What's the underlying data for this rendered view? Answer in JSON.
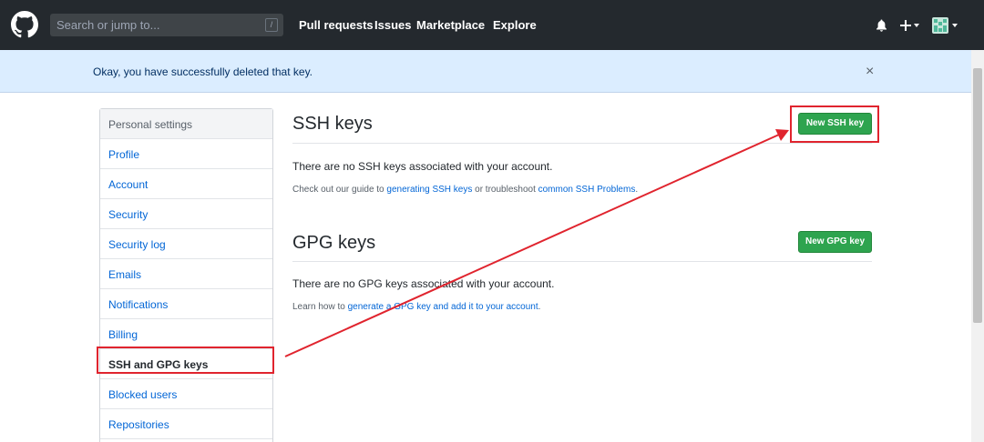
{
  "header": {
    "search_placeholder": "Search or jump to...",
    "slash_hint": "/",
    "nav": [
      "Pull requests",
      "Issues",
      "Marketplace",
      "Explore"
    ]
  },
  "flash": {
    "message": "Okay, you have successfully deleted that key.",
    "close": "×"
  },
  "sidebar": {
    "heading": "Personal settings",
    "items": [
      "Profile",
      "Account",
      "Security",
      "Security log",
      "Emails",
      "Notifications",
      "Billing",
      "SSH and GPG keys",
      "Blocked users",
      "Repositories"
    ],
    "selected": "SSH and GPG keys"
  },
  "ssh": {
    "title": "SSH keys",
    "button": "New SSH key",
    "empty": "There are no SSH keys associated with your account.",
    "help_prefix": "Check out our guide to ",
    "help_link1": "generating SSH keys",
    "help_mid": " or troubleshoot ",
    "help_link2": "common SSH Problems",
    "help_suffix": "."
  },
  "gpg": {
    "title": "GPG keys",
    "button": "New GPG key",
    "empty": "There are no GPG keys associated with your account.",
    "help_prefix": "Learn how to ",
    "help_link": "generate a GPG key and add it to your account",
    "help_suffix": "."
  },
  "colors": {
    "header_bg": "#24292e",
    "flash_bg": "#dbedff",
    "link": "#0366d6",
    "primary_button": "#2ea44f",
    "annotation": "#e0242e"
  }
}
